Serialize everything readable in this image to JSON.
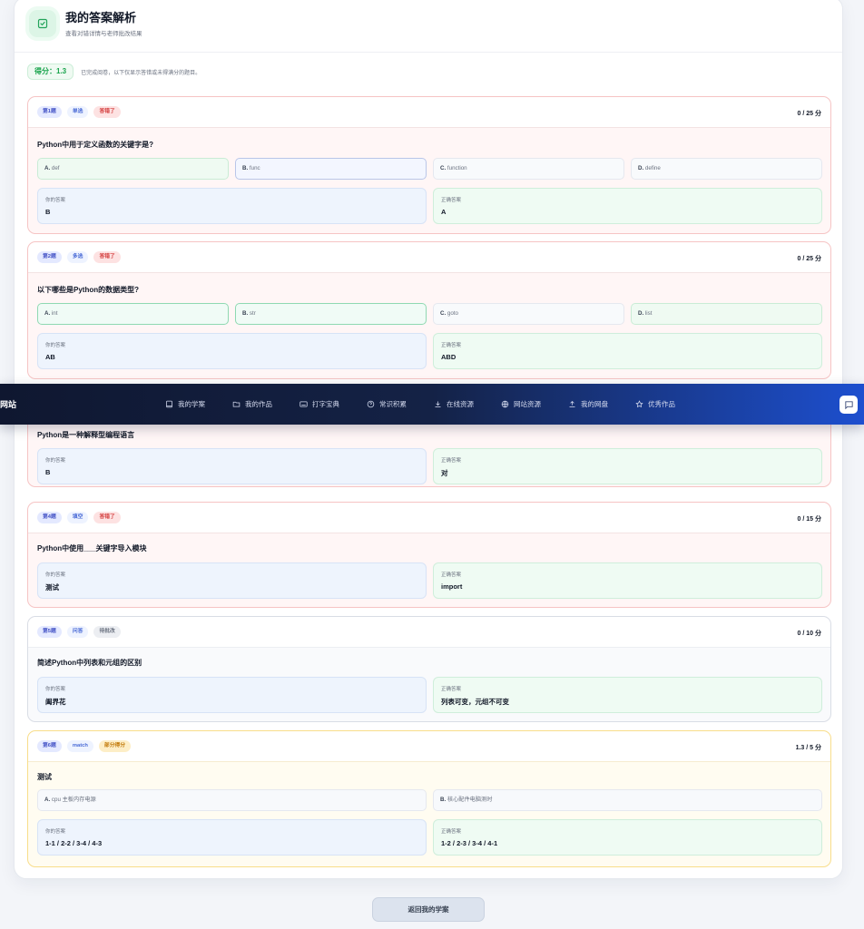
{
  "header": {
    "title": "我的答案解析",
    "subtitle": "查看对错详情与老师批改结果"
  },
  "score": {
    "label": "得分：1.3",
    "note": "已完成阅卷，以下仅显示答错或未得满分的题目。"
  },
  "questions": [
    {
      "number": "第1题",
      "type": "单选",
      "status": "答错了",
      "score": "0 / 25 分",
      "stem": "Python中用于定义函数的关键字是?",
      "options": [
        {
          "key": "A.",
          "text": "def"
        },
        {
          "key": "B.",
          "text": "func"
        },
        {
          "key": "C.",
          "text": "function"
        },
        {
          "key": "D.",
          "text": "define"
        }
      ],
      "your_answer_label": "你的答案",
      "your_answer": "B",
      "correct_answer_label": "正确答案",
      "correct_answer": "A"
    },
    {
      "number": "第2题",
      "type": "多选",
      "status": "答错了",
      "score": "0 / 25 分",
      "stem": "以下哪些是Python的数据类型?",
      "options": [
        {
          "key": "A.",
          "text": "int"
        },
        {
          "key": "B.",
          "text": "str"
        },
        {
          "key": "C.",
          "text": "goto"
        },
        {
          "key": "D.",
          "text": "list"
        }
      ],
      "your_answer_label": "你的答案",
      "your_answer": "AB",
      "correct_answer_label": "正确答案",
      "correct_answer": "ABD"
    },
    {
      "stem": "Python是一种解释型编程语言",
      "your_answer_label": "你的答案",
      "your_answer": "B",
      "correct_answer_label": "正确答案",
      "correct_answer": "对"
    },
    {
      "number": "第4题",
      "type": "填空",
      "status": "答错了",
      "score": "0 / 15 分",
      "stem": "Python中使用___关键字导入模块",
      "your_answer_label": "你的答案",
      "your_answer": "测试",
      "correct_answer_label": "正确答案",
      "correct_answer": "import"
    },
    {
      "number": "第5题",
      "type": "问答",
      "status": "待批改",
      "score": "0 / 10 分",
      "stem": "简述Python中列表和元组的区别",
      "your_answer_label": "你的答案",
      "your_answer": "阖界花",
      "correct_answer_label": "正确答案",
      "correct_answer": "列表可变，元组不可变"
    },
    {
      "number": "第6题",
      "type": "match",
      "status": "部分得分",
      "score": "1.3 / 5 分",
      "stem": "测试",
      "options": [
        {
          "key": "A.",
          "text": "cpu 主板内存电源"
        },
        {
          "key": "B.",
          "text": "核心配件电脑测时"
        }
      ],
      "your_answer_label": "你的答案",
      "your_answer": "1-1 / 2-2 / 3-4 / 4-3",
      "correct_answer_label": "正确答案",
      "correct_answer": "1-2 / 2-3 / 3-4 / 4-1"
    }
  ],
  "navbar": {
    "brand": "网站",
    "items": [
      {
        "label": "我的学案",
        "icon": "book-icon"
      },
      {
        "label": "我的作品",
        "icon": "folder-icon"
      },
      {
        "label": "打字宝典",
        "icon": "keyboard-icon"
      },
      {
        "label": "常识积累",
        "icon": "help-circle-icon"
      },
      {
        "label": "在线资源",
        "icon": "download-icon"
      },
      {
        "label": "网站资源",
        "icon": "globe-icon"
      },
      {
        "label": "我的网盘",
        "icon": "upload-icon"
      },
      {
        "label": "优秀作品",
        "icon": "star-icon"
      }
    ]
  },
  "back_button": "返回我的学案",
  "colors": {
    "accent_green": "#16a34a",
    "wrong_red": "#d33a3a",
    "nav_dark": "#0f1730",
    "nav_blue": "#1d4fcf"
  }
}
